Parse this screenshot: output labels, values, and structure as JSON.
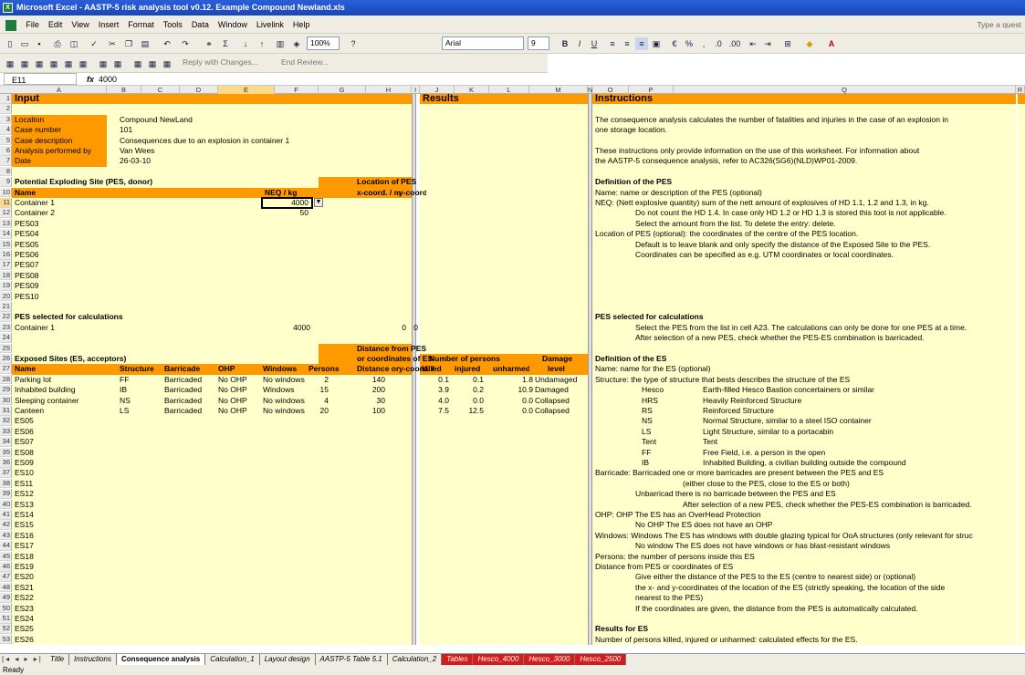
{
  "window": {
    "title": "Microsoft Excel - AASTP-5 risk analysis tool v0.12. Example Compound Newland.xls",
    "help_placeholder": "Type a quest"
  },
  "menu": [
    "File",
    "Edit",
    "View",
    "Insert",
    "Format",
    "Tools",
    "Data",
    "Window",
    "Livelink",
    "Help"
  ],
  "toolbar": {
    "zoom": "100%",
    "font": "Arial",
    "size": "9",
    "reply_label": "Reply with Changes...",
    "end_review": "End Review..."
  },
  "formula_bar": {
    "cell": "E11",
    "fx": "fx",
    "value": "4000"
  },
  "columns": [
    "A",
    "B",
    "C",
    "D",
    "E",
    "F",
    "G",
    "H",
    "I",
    "J",
    "K",
    "L",
    "M",
    "N",
    "O",
    "P",
    "Q",
    "R"
  ],
  "input": {
    "title": "Input",
    "meta": [
      {
        "label": "Location",
        "value": "Compound NewLand"
      },
      {
        "label": "Case number",
        "value": "101"
      },
      {
        "label": "Case description",
        "value": "Consequences due to an explosion in container 1"
      },
      {
        "label": "Analysis performed by",
        "value": "Van Wees"
      },
      {
        "label": "Date",
        "value": "26-03-10"
      }
    ],
    "pes_header": "Potential Exploding Site (PES, donor)",
    "pes_cols": {
      "name": "Name",
      "neq": "NEQ / kg",
      "loc": "Location of PES",
      "x": "x-coord. / m",
      "y": "y-coord. / m"
    },
    "pes_rows": [
      {
        "name": "Container 1",
        "neq": "4000"
      },
      {
        "name": "Container 2",
        "neq": "50"
      },
      {
        "name": "PES03",
        "neq": ""
      },
      {
        "name": "PES04",
        "neq": ""
      },
      {
        "name": "PES05",
        "neq": ""
      },
      {
        "name": "PES06",
        "neq": ""
      },
      {
        "name": "PES07",
        "neq": ""
      },
      {
        "name": "PES08",
        "neq": ""
      },
      {
        "name": "PES09",
        "neq": ""
      },
      {
        "name": "PES10",
        "neq": ""
      }
    ],
    "pes_selected_header": "PES selected for calculations",
    "pes_selected": {
      "name": "Container 1",
      "neq": "4000",
      "x": "0",
      "y": "0"
    },
    "es_dist_header1": "Distance from PES",
    "es_dist_header2": "or coordinates of ES",
    "es_header": "Exposed Sites (ES, acceptors)",
    "es_cols": {
      "name": "Name",
      "structure": "Structure",
      "barricade": "Barricade",
      "ohp": "OHP",
      "windows": "Windows",
      "persons": "Persons",
      "dist": "Distance or",
      "y": "y-coord. / m"
    },
    "es_rows": [
      {
        "name": "Parking lot",
        "structure": "FF",
        "barricade": "Barricaded",
        "ohp": "No OHP",
        "windows": "No windows",
        "persons": "2",
        "dist": "140"
      },
      {
        "name": "Inhabited building",
        "structure": "IB",
        "barricade": "Barricaded",
        "ohp": "No OHP",
        "windows": "Windows",
        "persons": "15",
        "dist": "200"
      },
      {
        "name": "Sleeping container",
        "structure": "NS",
        "barricade": "Barricaded",
        "ohp": "No OHP",
        "windows": "No windows",
        "persons": "4",
        "dist": "30"
      },
      {
        "name": "Canteen",
        "structure": "LS",
        "barricade": "Barricaded",
        "ohp": "No OHP",
        "windows": "No windows",
        "persons": "20",
        "dist": "100"
      },
      {
        "name": "ES05"
      },
      {
        "name": "ES06"
      },
      {
        "name": "ES07"
      },
      {
        "name": "ES08"
      },
      {
        "name": "ES09"
      },
      {
        "name": "ES10"
      },
      {
        "name": "ES11"
      },
      {
        "name": "ES12"
      },
      {
        "name": "ES13"
      },
      {
        "name": "ES14"
      },
      {
        "name": "ES15"
      },
      {
        "name": "ES16"
      },
      {
        "name": "ES17"
      },
      {
        "name": "ES18"
      },
      {
        "name": "ES19"
      },
      {
        "name": "ES20"
      },
      {
        "name": "ES21"
      },
      {
        "name": "ES22"
      },
      {
        "name": "ES23"
      },
      {
        "name": "ES24"
      },
      {
        "name": "ES25"
      },
      {
        "name": "ES26"
      }
    ]
  },
  "results": {
    "title": "Results",
    "h1": "Number of persons",
    "h1b": "Damage",
    "cols": [
      "killed",
      "injured",
      "unharmed",
      "level"
    ],
    "rows": [
      [
        "0.1",
        "0.1",
        "1.8",
        "Undamaged"
      ],
      [
        "3.9",
        "0.2",
        "10.9",
        "Damaged"
      ],
      [
        "4.0",
        "0.0",
        "0.0",
        "Collapsed"
      ],
      [
        "7.5",
        "12.5",
        "0.0",
        "Collapsed"
      ]
    ]
  },
  "instructions": {
    "title": "Instructions",
    "lines": [
      {
        "row": 3,
        "indent": 0,
        "text": "The consequence analysis calculates the number of fatalities and injuries in the case of an explosion in"
      },
      {
        "row": 4,
        "indent": 0,
        "text": "one storage location."
      },
      {
        "row": 6,
        "indent": 0,
        "text": "These instructions only provide information on the use of this worksheet. For information about"
      },
      {
        "row": 7,
        "indent": 0,
        "text": "the AASTP-5 consequence analysis, refer to AC326(SG6)(NLD)WP01-2009."
      },
      {
        "row": 9,
        "indent": 0,
        "bold": true,
        "text": "Definition of the PES"
      },
      {
        "row": 10,
        "indent": 0,
        "text": "Name: name or description of the PES (optional)"
      },
      {
        "row": 11,
        "indent": 0,
        "text": "NEQ: (Nett explosive quantity) sum of the nett amount of explosives of HD 1.1, 1.2 and 1.3, in kg."
      },
      {
        "row": 12,
        "indent": 1,
        "text": "Do not count the HD 1.4. In case only HD 1.2 or HD 1.3 is stored this tool is not applicable."
      },
      {
        "row": 13,
        "indent": 1,
        "text": "Select the amount from the list. To delete the entry: delete."
      },
      {
        "row": 14,
        "indent": 0,
        "text": "Location of PES (optional): the coordinates of the centre of the PES location."
      },
      {
        "row": 15,
        "indent": 1,
        "text": "Default is to leave blank and only specify the distance of the Exposed Site to the PES."
      },
      {
        "row": 16,
        "indent": 1,
        "text": "Coordinates can be specified as e.g. UTM coordinates or local coordinates."
      },
      {
        "row": 22,
        "indent": 0,
        "bold": true,
        "text": "PES selected for calculations"
      },
      {
        "row": 23,
        "indent": 1,
        "text": "Select the PES from the list in cell A23. The calculations can only be done for one PES at a time."
      },
      {
        "row": 24,
        "indent": 1,
        "text": "After selection of a new PES, check whether the PES-ES combination is barricaded."
      },
      {
        "row": 26,
        "indent": 0,
        "bold": true,
        "text": "Definition of the ES"
      },
      {
        "row": 27,
        "indent": 0,
        "text": "Name:     name for the ES (optional)"
      },
      {
        "row": 28,
        "indent": 0,
        "text": "Structure: the type of structure that bests describes the structure of the ES"
      },
      {
        "row": 29,
        "indent": 2,
        "k": "Hesco",
        "text": "Earth-filled Hesco Bastion concertainers or similar"
      },
      {
        "row": 30,
        "indent": 2,
        "k": "HRS",
        "text": "Heavily Reinforced Structure"
      },
      {
        "row": 31,
        "indent": 2,
        "k": "RS",
        "text": "Reinforced Structure"
      },
      {
        "row": 32,
        "indent": 2,
        "k": "NS",
        "text": "Normal Structure, similar to a steel ISO container"
      },
      {
        "row": 33,
        "indent": 2,
        "k": "LS",
        "text": "Light Structure, similar to a portacabin"
      },
      {
        "row": 34,
        "indent": 2,
        "k": "Tent",
        "text": "Tent"
      },
      {
        "row": 35,
        "indent": 2,
        "k": "FF",
        "text": "Free Field, i.e. a person in the open"
      },
      {
        "row": 36,
        "indent": 2,
        "k": "IB",
        "text": "Inhabited Building, a civilian building outside the compound"
      },
      {
        "row": 37,
        "indent": 0,
        "text": "Barricade:  Barricaded one or more barricades are present between the PES and ES"
      },
      {
        "row": 38,
        "indent": 3,
        "text": "(either close to the PES, close to the ES or both)"
      },
      {
        "row": 39,
        "indent": 1,
        "text": "Unbarricad there is no barricade between the PES and ES"
      },
      {
        "row": 40,
        "indent": 3,
        "text": "After selection of a new PES, check whether the PES-ES combination is barricaded."
      },
      {
        "row": 41,
        "indent": 0,
        "text": "OHP:       OHP        The ES has an OverHead Protection"
      },
      {
        "row": 42,
        "indent": 1,
        "text": "No OHP    The ES does not have an OHP"
      },
      {
        "row": 43,
        "indent": 0,
        "text": "Windows:  Windows    The ES has windows with double glazing typical for OoA structures (only relevant for struc"
      },
      {
        "row": 44,
        "indent": 1,
        "text": "No window The ES does not have windows or has blast-resistant windows"
      },
      {
        "row": 45,
        "indent": 0,
        "text": "Persons: the number of persons inside this ES"
      },
      {
        "row": 46,
        "indent": 0,
        "text": "Distance from PES or coordinates of ES"
      },
      {
        "row": 47,
        "indent": 1,
        "text": "Give either the distance of the PES to the ES (centre to nearest side) or (optional)"
      },
      {
        "row": 48,
        "indent": 1,
        "text": "the x- and y-coordinates of the location of the ES (strictly speaking, the location of the side"
      },
      {
        "row": 49,
        "indent": 1,
        "text": "nearest to the PES)"
      },
      {
        "row": 50,
        "indent": 1,
        "text": "If the coordinates are given, the distance from the PES is automatically calculated."
      },
      {
        "row": 52,
        "indent": 0,
        "bold": true,
        "text": "Results for ES"
      },
      {
        "row": 53,
        "indent": 0,
        "text": "Number of persons killed, injured or unharmed: calculated effects for the ES."
      }
    ]
  },
  "sheets": [
    {
      "label": "Title",
      "style": "normal"
    },
    {
      "label": "Instructions",
      "style": "normal"
    },
    {
      "label": "Consequence analysis",
      "style": "active"
    },
    {
      "label": "Calculation_1",
      "style": "normal"
    },
    {
      "label": "Layout design",
      "style": "normal"
    },
    {
      "label": "AASTP-5 Table 5.1",
      "style": "normal"
    },
    {
      "label": "Calculation_2",
      "style": "normal"
    },
    {
      "label": "Tables",
      "style": "red"
    },
    {
      "label": "Hesco_4000",
      "style": "red"
    },
    {
      "label": "Hesco_3000",
      "style": "red"
    },
    {
      "label": "Hesco_2500",
      "style": "red"
    }
  ],
  "status": "Ready"
}
